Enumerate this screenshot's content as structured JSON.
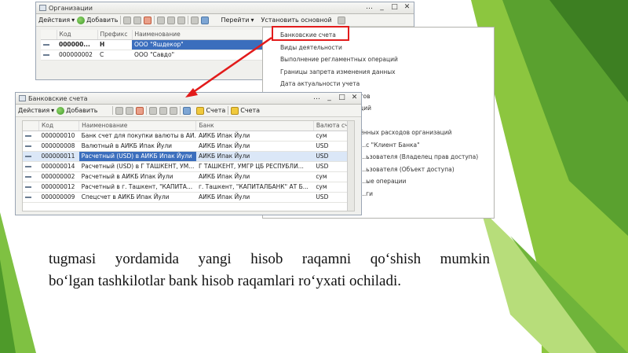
{
  "org_window": {
    "title": "Организации",
    "toolbar": {
      "actions": "Действия",
      "add": "Добавить",
      "reports": "Перейти",
      "main_set": "Установить основной"
    },
    "columns": [
      "Код",
      "Префикс",
      "Наименование"
    ],
    "rows": [
      {
        "code": "000000...",
        "prefix": "Н",
        "name": "ООО \"Яшдекор\""
      },
      {
        "code": "000000002",
        "prefix": "С",
        "name": "ООО \"Савдо\""
      }
    ]
  },
  "context_menu": {
    "items": [
      "Банковские счета",
      "Виды деятельности",
      "Выполнение регламентных операций",
      "Границы запрета изменения данных",
      "Дата актуальности учета",
      "...тов",
      "...ций",
      "",
      "...ённых расходов организаций",
      "...с \"Клиент Банка\"",
      "...ьзователя (Владелец прав доступа)",
      "...ьзователя (Объект доступа)",
      "...ые операции",
      "...ги"
    ]
  },
  "bank_window": {
    "title": "Банковские счета",
    "toolbar": {
      "actions": "Действия",
      "add": "Добавить",
      "accounts1": "Счета",
      "accounts2": "Счета"
    },
    "columns": [
      "Код",
      "Наименование",
      "Банк",
      "Валюта сч..."
    ],
    "rows": [
      {
        "code": "000000010",
        "name": "Банк счет для покупки валюты в АИ...",
        "bank": "АИКБ Ипак Йули",
        "cur": "сум"
      },
      {
        "code": "000000008",
        "name": "Валютный в АИКБ Ипак Йули",
        "bank": "АИКБ Ипак Йули",
        "cur": "USD"
      },
      {
        "code": "000000011",
        "name": "Расчетный (USD) в АИКБ Ипак Йули",
        "bank": "АИКБ Ипак Йули",
        "cur": "USD"
      },
      {
        "code": "000000014",
        "name": "Расчетный (USD) в Г ТАШКЕНТ, УМ...",
        "bank": "Г ТАШКЕНТ, УМГР ЦБ РЕСПУБЛИ...",
        "cur": "USD"
      },
      {
        "code": "000000002",
        "name": "Расчетный в АИКБ Ипак Йули",
        "bank": "АИКБ Ипак Йули",
        "cur": "сум"
      },
      {
        "code": "000000012",
        "name": "Расчетный в г. Ташкент, \"КАПИТА...",
        "bank": "г. Ташкент, \"КАПИТАЛБАНК\" АТ Б...",
        "cur": "сум"
      },
      {
        "code": "000000009",
        "name": "Спецсчет в АИКБ Ипак Йули",
        "bank": "АИКБ Ипак Йули",
        "cur": "USD"
      }
    ]
  },
  "caption": {
    "line1": [
      "tugmasi",
      "yordamida",
      "yangi",
      "hisob",
      "raqamni",
      "qo‘shish",
      "mumkin"
    ],
    "line2": "bo‘lgan tashkilotlar bank hisob raqamlari ro‘yxati ochiladi."
  },
  "colors": {
    "accent_green": "#4e9a2a",
    "highlight_red": "#e21b1b",
    "selection_blue": "#3b6ebd"
  }
}
